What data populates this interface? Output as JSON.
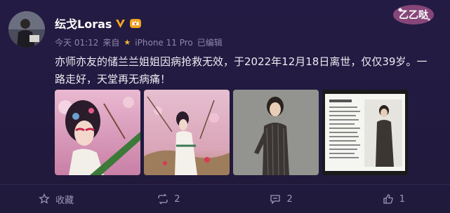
{
  "post": {
    "author": "纭戈Loras",
    "time": "今天 01:12",
    "source_prefix": "来自",
    "source": "iPhone 11 Pro",
    "edited": "已编辑",
    "text": "亦师亦友的储兰兰姐姐因病抢救无效，于2022年12月18日离世，仅仅39岁。一路走好，天堂再无病痛！",
    "images": [
      "opera-portrait-1",
      "opera-portrait-2",
      "qipao-portrait",
      "article-screenshot"
    ]
  },
  "decor": {
    "label": "乙乙哒"
  },
  "actions": {
    "favorite_label": "收藏",
    "repost_count": "2",
    "comment_count": "2",
    "like_count": "1"
  },
  "colors": {
    "background": "#221a3e",
    "accent_star": "#f5b633",
    "muted_text": "#8c88a8"
  }
}
